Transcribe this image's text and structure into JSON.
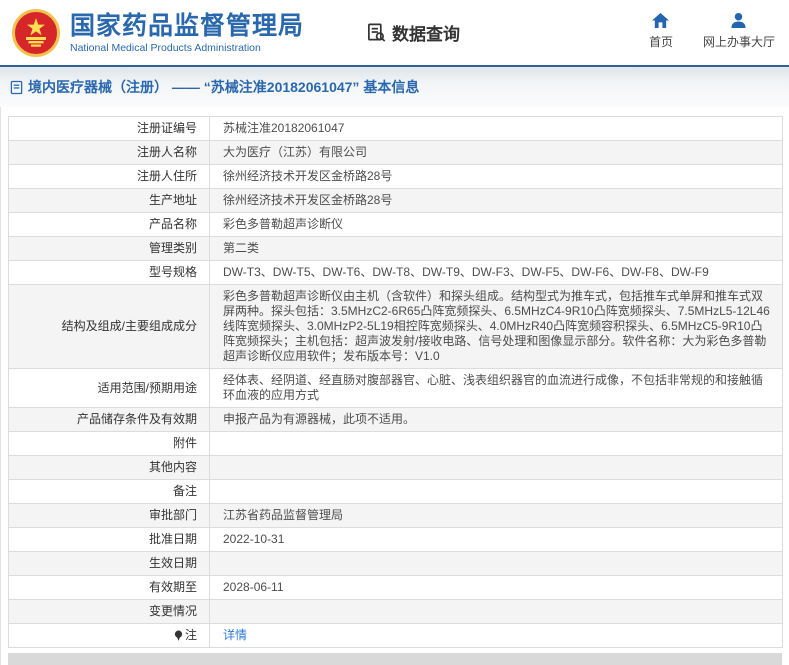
{
  "header": {
    "agency_name_cn": "国家药品监督管理局",
    "agency_name_en": "National Medical Products Administration",
    "section_title": "数据查询",
    "nav": [
      {
        "label": "首页",
        "icon": "home-icon"
      },
      {
        "label": "网上办事大厅",
        "icon": "person-icon"
      }
    ]
  },
  "breadcrumb": {
    "text": "境内医疗器械（注册） —— “苏械注准20182061047” 基本信息"
  },
  "table": {
    "rows": [
      {
        "label": "注册证编号",
        "value": "苏械注准20182061047"
      },
      {
        "label": "注册人名称",
        "value": "大为医疗（江苏）有限公司"
      },
      {
        "label": "注册人住所",
        "value": "徐州经济技术开发区金桥路28号"
      },
      {
        "label": "生产地址",
        "value": "徐州经济技术开发区金桥路28号"
      },
      {
        "label": "产品名称",
        "value": "彩色多普勒超声诊断仪"
      },
      {
        "label": "管理类别",
        "value": "第二类"
      },
      {
        "label": "型号规格",
        "value": "DW-T3、DW-T5、DW-T6、DW-T8、DW-T9、DW-F3、DW-F5、DW-F6、DW-F8、DW-F9"
      },
      {
        "label": "结构及组成/主要组成成分",
        "value": "彩色多普勒超声诊断仪由主机（含软件）和探头组成。结构型式为推车式，包括推车式单屏和推车式双屏两种。探头包括：3.5MHzC2-6R65凸阵宽频探头、6.5MHzC4-9R10凸阵宽频探头、7.5MHzL5-12L46线阵宽频探头、3.0MHzP2-5L19相控阵宽频探头、4.0MHzR40凸阵宽频容积探头、6.5MHzC5-9R10凸阵宽频探头；主机包括：超声波发射/接收电路、信号处理和图像显示部分。软件名称：大为彩色多普勒超声诊断仪应用软件；发布版本号：V1.0"
      },
      {
        "label": "适用范围/预期用途",
        "value": "经体表、经阴道、经直肠对腹部器官、心脏、浅表组织器官的血流进行成像，不包括非常规的和接触循环血液的应用方式"
      },
      {
        "label": "产品储存条件及有效期",
        "value": "申报产品为有源器械，此项不适用。"
      },
      {
        "label": "附件",
        "value": ""
      },
      {
        "label": "其他内容",
        "value": ""
      },
      {
        "label": "备注",
        "value": ""
      },
      {
        "label": "审批部门",
        "value": "江苏省药品监督管理局"
      },
      {
        "label": "批准日期",
        "value": "2022-10-31"
      },
      {
        "label": "生效日期",
        "value": ""
      },
      {
        "label": "有效期至",
        "value": "2028-06-11"
      },
      {
        "label": "变更情况",
        "value": ""
      },
      {
        "label": "注",
        "value": "详情",
        "link": true,
        "icon": "pin-icon"
      }
    ]
  },
  "colors": {
    "accent_blue": "#2a68ad",
    "icon_blue": "#2465b0",
    "line_blue": "#2f6397",
    "link_blue": "#2d7bd8",
    "row_alt": "#f4f4f4",
    "border": "#c9c9c9",
    "inner_border": "#dcdcdc",
    "dark": "#333333",
    "footer_gray": "#d9d9d9",
    "emblem_red": "#d7262a",
    "emblem_gold": "#f2c24e"
  }
}
